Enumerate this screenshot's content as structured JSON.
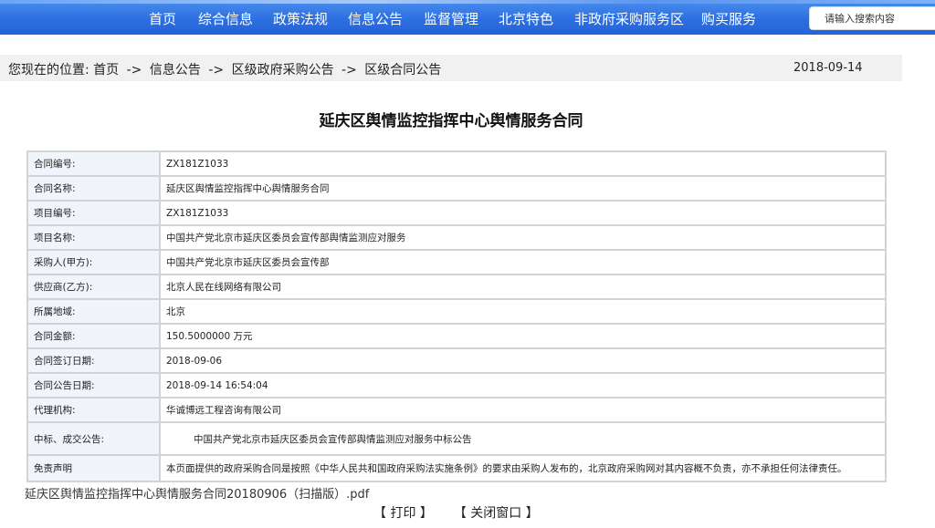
{
  "nav": {
    "items": [
      "首页",
      "综合信息",
      "政策法规",
      "信息公告",
      "监督管理",
      "北京特色",
      "非政府采购服务区",
      "购买服务"
    ],
    "search_placeholder": "请输入搜索内容"
  },
  "breadcrumb": {
    "prefix": "您现在的位置:",
    "items": [
      "首页",
      "信息公告",
      "区级政府采购公告",
      "区级合同公告"
    ],
    "separator": "->",
    "date": "2018-09-14"
  },
  "page_title": "延庆区舆情监控指挥中心舆情服务合同",
  "contract": {
    "rows": [
      {
        "label": "合同编号:",
        "value": "ZX181Z1033"
      },
      {
        "label": "合同名称:",
        "value": "延庆区舆情监控指挥中心舆情服务合同"
      },
      {
        "label": "项目编号:",
        "value": "ZX181Z1033"
      },
      {
        "label": "项目名称:",
        "value": "中国共产党北京市延庆区委员会宣传部舆情监测应对服务"
      },
      {
        "label": "采购人(甲方):",
        "value": "中国共产党北京市延庆区委员会宣传部"
      },
      {
        "label": "供应商(乙方):",
        "value": "北京人民在线网络有限公司"
      },
      {
        "label": "所属地域:",
        "value": "北京"
      },
      {
        "label": "合同金额:",
        "value": "150.5000000 万元"
      },
      {
        "label": "合同签订日期:",
        "value": "2018-09-06"
      },
      {
        "label": "合同公告日期:",
        "value": "2018-09-14 16:54:04"
      },
      {
        "label": "代理机构:",
        "value": "华诚博远工程咨询有限公司"
      },
      {
        "label": "中标、成交公告:",
        "value": "中国共产党北京市延庆区委员会宣传部舆情监测应对服务中标公告"
      },
      {
        "label": "免责声明",
        "value": "本页面提供的政府采购合同是按照《中华人民共和国政府采购法实施条例》的要求由采购人发布的，北京政府采购网对其内容概不负责，亦不承担任何法律责任。"
      }
    ]
  },
  "attachment": "延庆区舆情监控指挥中心舆情服务合同20180906（扫描版）.pdf",
  "actions": {
    "print": "【 打印 】",
    "close": "【 关闭窗口 】"
  }
}
